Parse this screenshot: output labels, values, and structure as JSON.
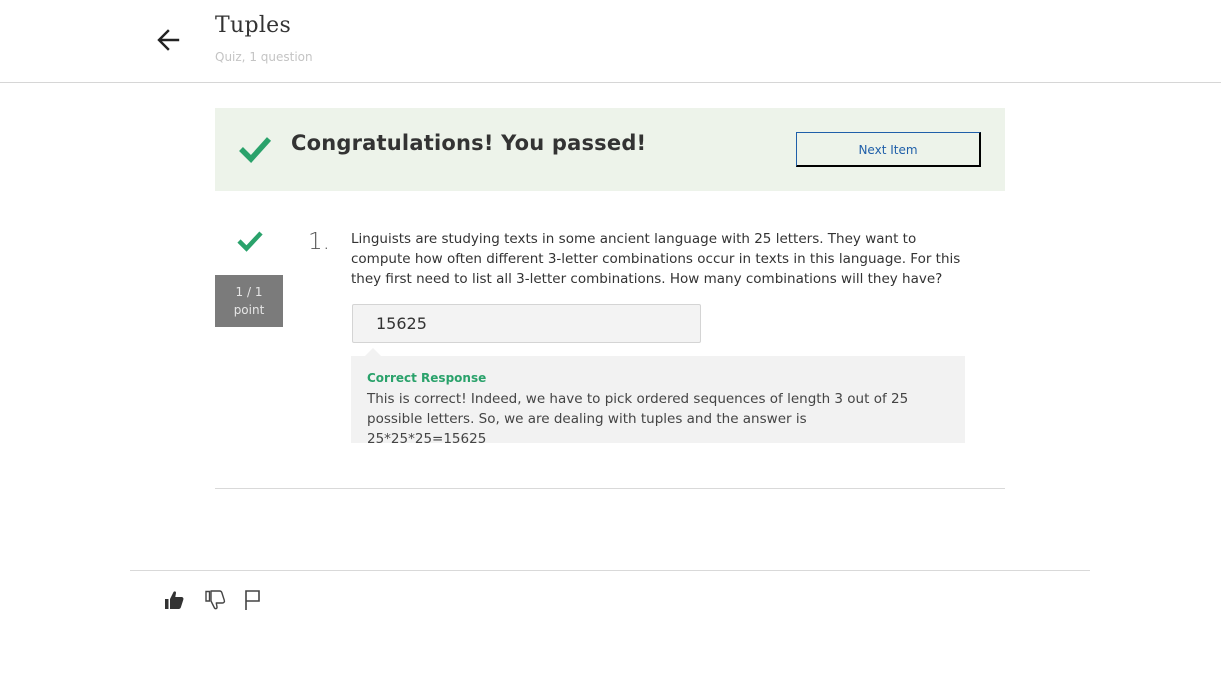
{
  "header": {
    "back_icon": "arrow-left-icon",
    "title": "Tuples",
    "subtitle": "Quiz, 1 question"
  },
  "banner": {
    "check_icon": "checkmark-icon",
    "message": "Congratulations! You passed!",
    "next_button_label": "Next Item"
  },
  "question": {
    "status_icon": "checkmark-icon",
    "score": "1 / 1",
    "score_unit": "point",
    "number": "1.",
    "text": "Linguists are studying texts in some ancient language with 25 letters. They want to compute how often different 3-letter combinations occur in texts in this language. For this they first need to list all 3-letter combinations. How many combinations will they have?",
    "answer_value": "15625",
    "feedback_title": "Correct Response",
    "feedback_text": "This is correct! Indeed, we have to pick ordered sequences of length 3 out of 25 possible letters. So, we are dealing with tuples and the answer is 25*25*25=15625"
  },
  "footer": {
    "icons": [
      "thumbs-up-icon",
      "thumbs-down-icon",
      "flag-icon"
    ]
  },
  "colors": {
    "success_green": "#2aa26b",
    "banner_bg": "#edf3ea",
    "link_blue": "#1f5fa9",
    "points_bg": "#7b7b7b"
  }
}
